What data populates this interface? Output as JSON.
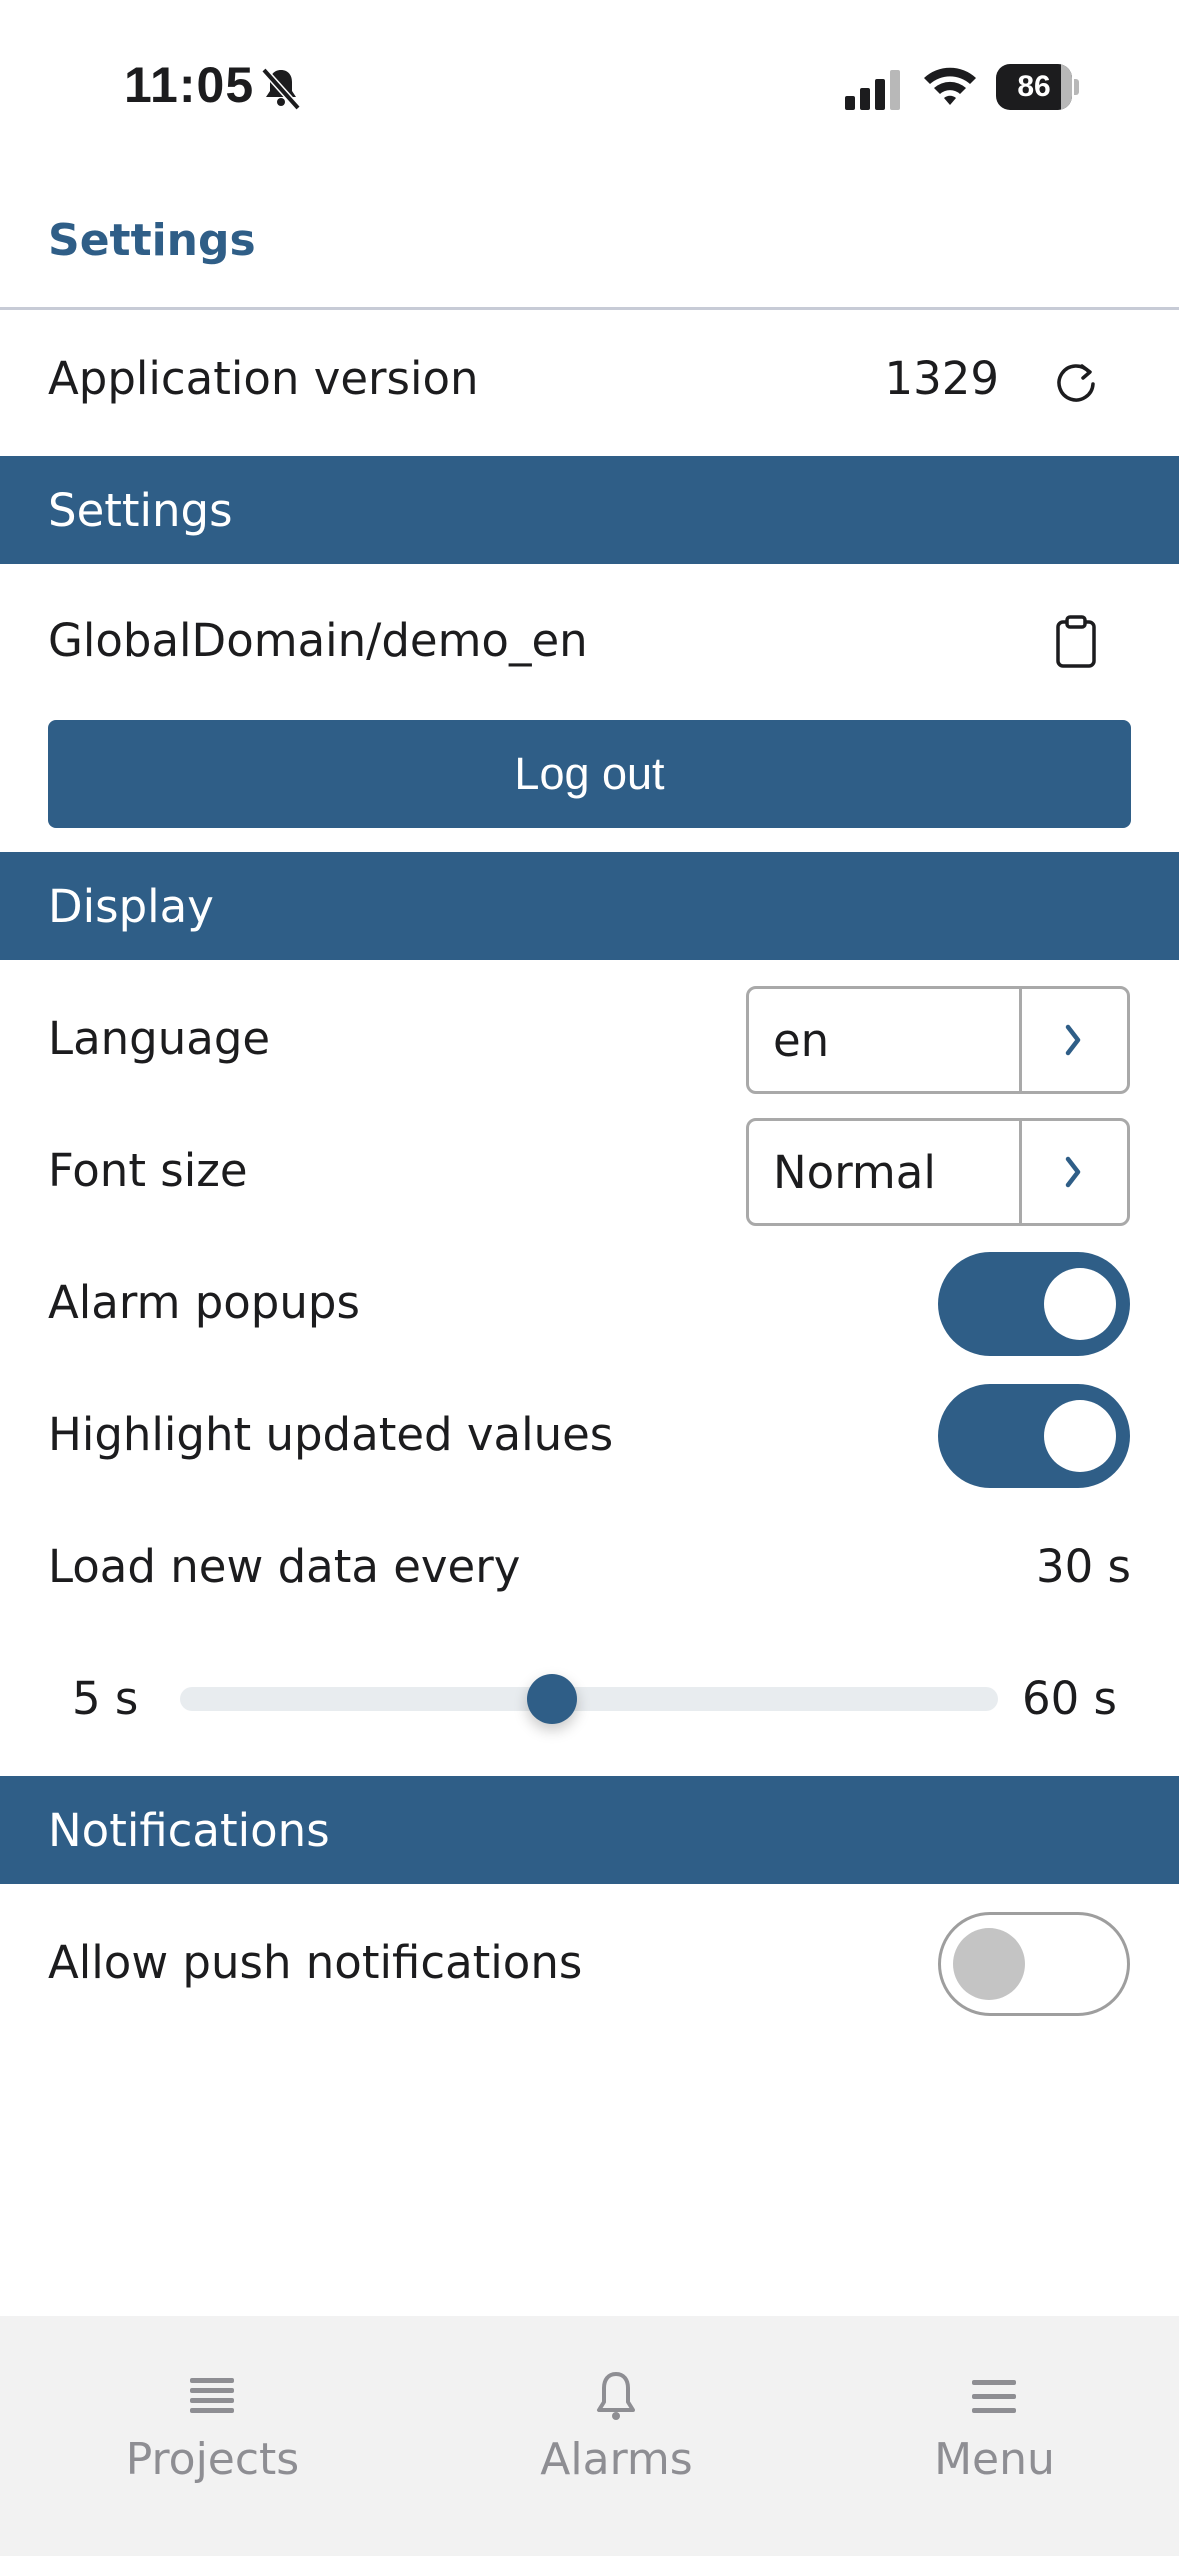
{
  "status_bar": {
    "time": "11:05",
    "battery": "86",
    "battery_level_percent": 86
  },
  "header": {
    "title": "Settings"
  },
  "app_version": {
    "label": "Application version",
    "value": "1329",
    "refresh_icon": "refresh-icon"
  },
  "sections": {
    "settings": "Settings",
    "display": "Display",
    "notifications": "Notifications"
  },
  "account": {
    "domain": "GlobalDomain/demo_en",
    "copy_icon": "clipboard-icon",
    "logout_label": "Log out"
  },
  "display": {
    "language": {
      "label": "Language",
      "value": "en"
    },
    "font_size": {
      "label": "Font size",
      "value": "Normal"
    },
    "alarm_popups": {
      "label": "Alarm popups",
      "enabled": true
    },
    "highlight_updates": {
      "label": "Highlight updated values",
      "enabled": true
    },
    "refresh_interval": {
      "label": "Load new data every",
      "value_text": "30 s",
      "value": 30,
      "min": 5,
      "max": 60,
      "min_label": "5 s",
      "max_label": "60 s"
    }
  },
  "notifications": {
    "push": {
      "label": "Allow push notifications",
      "enabled": false
    }
  },
  "tabbar": {
    "items": [
      {
        "label": "Projects",
        "icon": "list-icon"
      },
      {
        "label": "Alarms",
        "icon": "bell-icon"
      },
      {
        "label": "Menu",
        "icon": "menu-icon"
      }
    ]
  },
  "colors": {
    "accent": "#2f5e87",
    "tab_inactive": "#8e8e93"
  }
}
